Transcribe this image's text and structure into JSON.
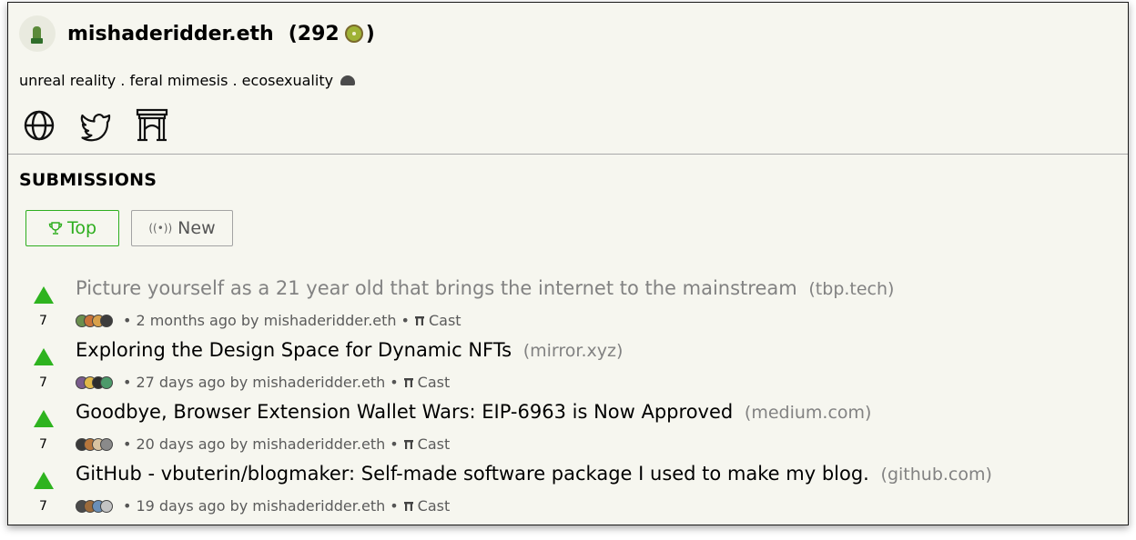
{
  "profile": {
    "username": "mishaderidder.eth",
    "score_open": "(292",
    "score_close": ")",
    "score_icon": "kiwi-icon",
    "avatar_icon": "cactus-avatar",
    "bio": "unreal reality . feral mimesis . ecosexuality",
    "bio_icon": "rock-icon",
    "links": [
      "globe-icon",
      "twitter-bird-icon",
      "farcaster-arch-icon"
    ]
  },
  "section": {
    "title": "SUBMISSIONS"
  },
  "tabs": [
    {
      "label": "Top",
      "icon": "trophy-icon",
      "active": true
    },
    {
      "label": "New",
      "icon": "broadcast-icon",
      "active": false
    }
  ],
  "colors": {
    "accent_green": "#2eae1f",
    "page_background": "#f6f6ef",
    "muted_text": "#828282"
  },
  "stories": [
    {
      "title": "Picture yourself as a 21 year old that brings the internet to the mainstream",
      "domain": "(tbp.tech)",
      "votes": "7",
      "age": "2 months ago by mishaderidder.eth",
      "cast_label": "Cast",
      "visited": true,
      "upvoter_colors": [
        "#6b8f4e",
        "#c9733a",
        "#d8a04a",
        "#3d3d3d"
      ]
    },
    {
      "title": "Exploring the Design Space for Dynamic NFTs",
      "domain": "(mirror.xyz)",
      "votes": "7",
      "age": "27 days ago by mishaderidder.eth",
      "cast_label": "Cast",
      "visited": false,
      "upvoter_colors": [
        "#7a5c8c",
        "#e0b84a",
        "#2c2c2c",
        "#4c9a6a"
      ]
    },
    {
      "title": "Goodbye, Browser Extension Wallet Wars: EIP-6963 is Now Approved",
      "domain": "(medium.com)",
      "votes": "7",
      "age": "20 days ago by mishaderidder.eth",
      "cast_label": "Cast",
      "visited": false,
      "upvoter_colors": [
        "#3a3a3a",
        "#b7763c",
        "#d9c3a0",
        "#8a8a8a"
      ]
    },
    {
      "title": "GitHub - vbuterin/blogmaker: Self-made software package I used to make my blog.",
      "domain": "(github.com)",
      "votes": "7",
      "age": "19 days ago by mishaderidder.eth",
      "cast_label": "Cast",
      "visited": false,
      "upvoter_colors": [
        "#4b4b4b",
        "#9c6b3c",
        "#6a8fb8",
        "#c4c4c4"
      ]
    }
  ]
}
